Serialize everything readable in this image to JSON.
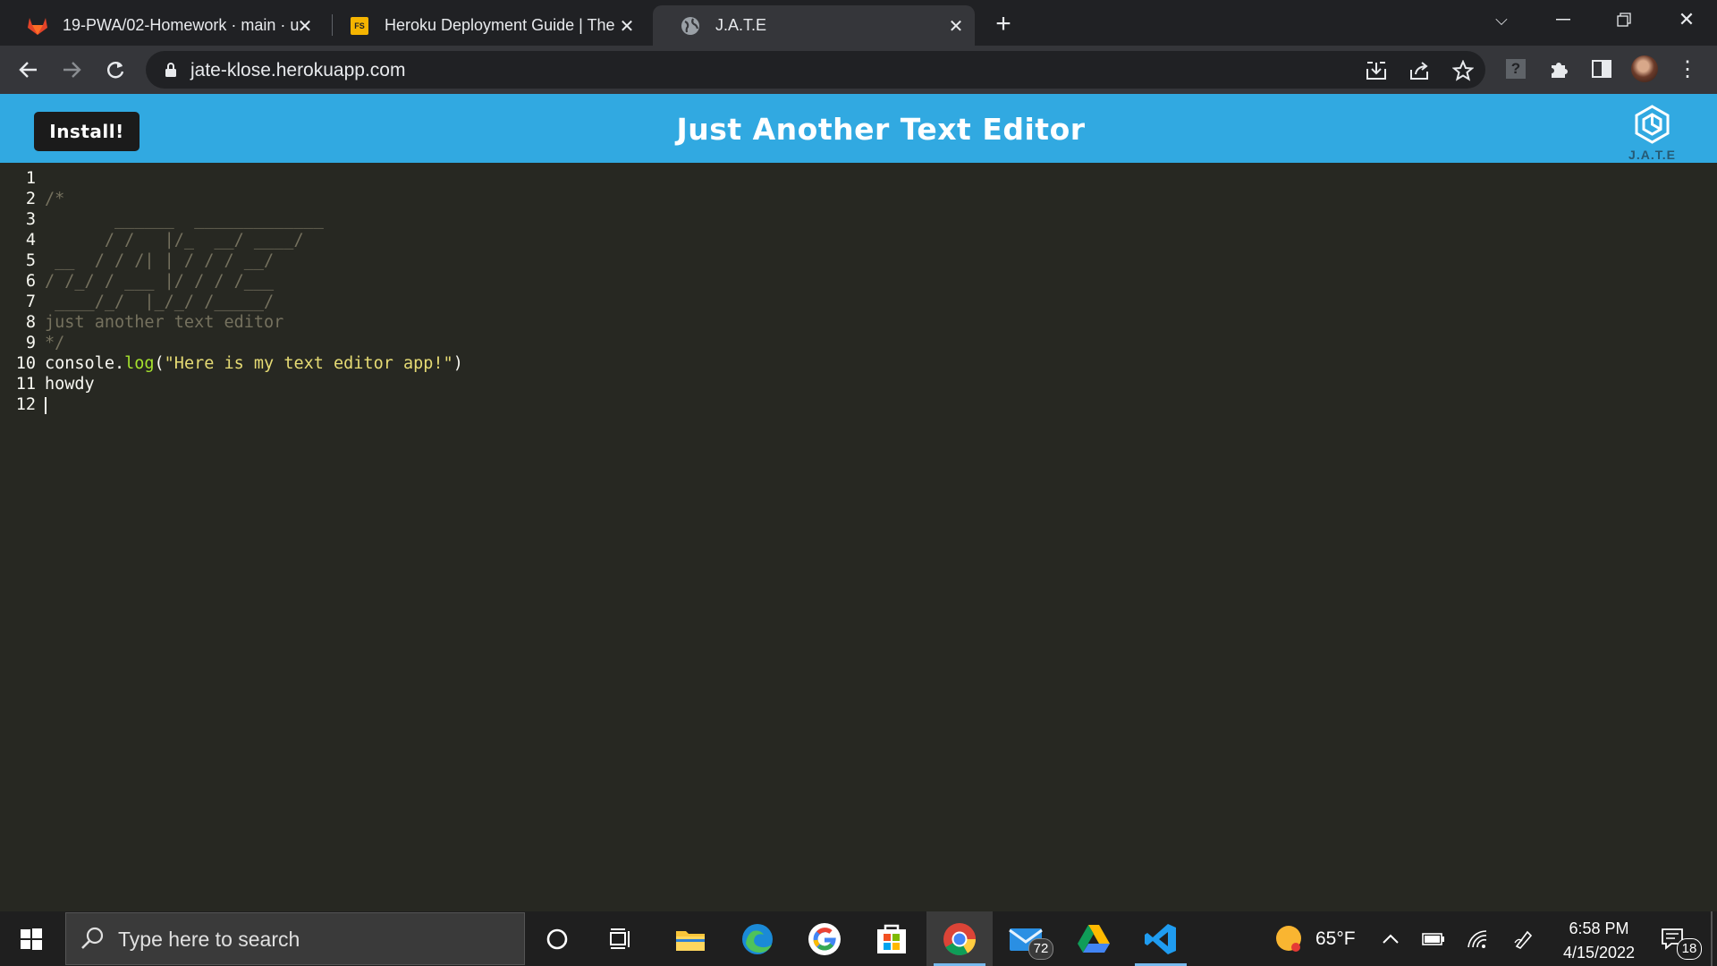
{
  "browser": {
    "tabs": [
      {
        "title": "19-PWA/02-Homework · main · u",
        "icon": "gitlab-icon",
        "active": false
      },
      {
        "title": "Heroku Deployment Guide | The",
        "icon": "fs-icon",
        "favicon_text": "FS",
        "active": false
      },
      {
        "title": "J.A.T.E",
        "icon": "globe-icon",
        "active": true
      }
    ],
    "url": "jate-klose.herokuapp.com"
  },
  "app": {
    "install_label": "Install!",
    "title": "Just Another Text Editor",
    "logo_text": "J.A.T.E",
    "header_color": "#31a9e1"
  },
  "editor": {
    "lines": [
      {
        "n": "1",
        "text": ""
      },
      {
        "n": "2",
        "text": "/*"
      },
      {
        "n": "3",
        "text": "       ______  _____________"
      },
      {
        "n": "4",
        "text": "      / /   |/_  __/ ____/"
      },
      {
        "n": "5",
        "text": " __  / / /| | / / / __/"
      },
      {
        "n": "6",
        "text": "/ /_/ / ___ |/ / / /___"
      },
      {
        "n": "7",
        "text": " ____/_/  |_/_/ /_____/"
      },
      {
        "n": "8",
        "text": "just another text editor"
      },
      {
        "n": "9",
        "text": "*/"
      },
      {
        "n": "10",
        "text_pre": "console.",
        "text_fn": "log",
        "text_open": "(",
        "text_str": "\"Here is my text editor app!\"",
        "text_close": ")"
      },
      {
        "n": "11",
        "text": "howdy"
      },
      {
        "n": "12",
        "text": ""
      }
    ],
    "theme": {
      "background": "#272822",
      "comment": "#75715e",
      "function": "#a6e22e",
      "string": "#e6db74"
    }
  },
  "taskbar": {
    "search_placeholder": "Type here to search",
    "mail_badge": "72",
    "weather": "65°F",
    "time": "6:58 PM",
    "date": "4/15/2022",
    "notifications": "18"
  }
}
